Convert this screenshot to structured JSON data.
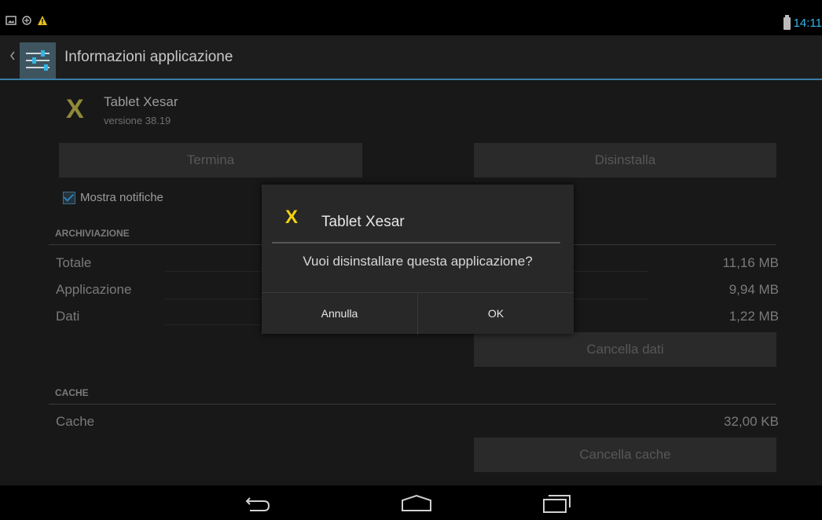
{
  "status_bar": {
    "time": "14:11"
  },
  "action_bar": {
    "title": "Informazioni applicazione"
  },
  "app": {
    "icon_letter": "X",
    "name": "Tablet Xesar",
    "version": "versione 38.19"
  },
  "buttons": {
    "terminate": "Termina",
    "uninstall": "Disinstalla",
    "clear_data": "Cancella dati",
    "clear_cache": "Cancella cache"
  },
  "notifications": {
    "label": "Mostra notifiche",
    "checked": true
  },
  "storage": {
    "header": "ARCHIVIAZIONE",
    "rows": [
      {
        "label": "Totale",
        "value": "11,16 MB"
      },
      {
        "label": "Applicazione",
        "value": "9,94 MB"
      },
      {
        "label": "Dati",
        "value": "1,22 MB"
      }
    ]
  },
  "cache": {
    "header": "CACHE",
    "label": "Cache",
    "value": "32,00 KB"
  },
  "dialog": {
    "icon_letter": "X",
    "title": "Tablet Xesar",
    "message": "Vuoi disinstallare questa applicazione?",
    "cancel": "Annulla",
    "ok": "OK"
  },
  "colors": {
    "accent": "#33b5e5",
    "dialog_icon": "#f2d30e",
    "bg": "#181818"
  }
}
